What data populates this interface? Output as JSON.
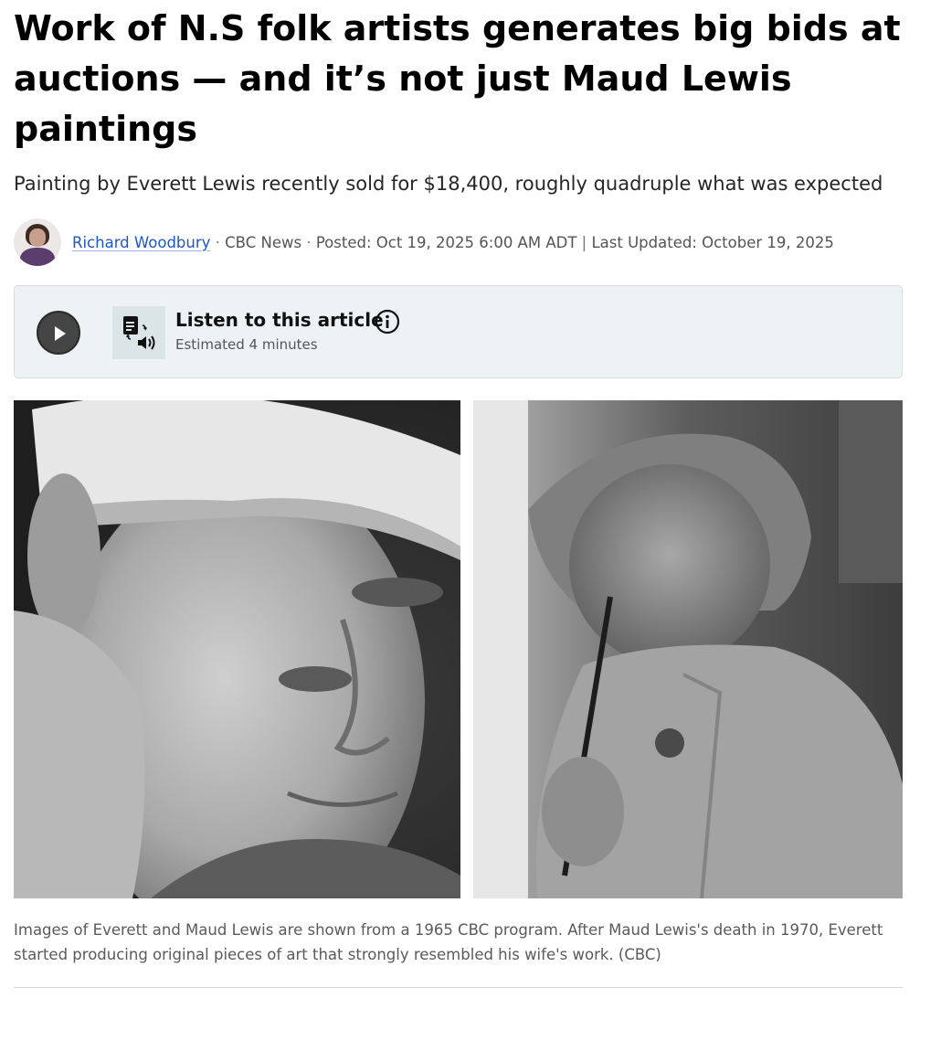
{
  "article": {
    "headline": "Work of N.S folk artists generates big bids at auctions — and it’s not just Maud Lewis paintings",
    "subheadline": "Painting by Everett Lewis recently sold for $18,400, roughly quadruple what was expected",
    "byline": {
      "author": "Richard Woodbury",
      "outlet": "CBC News",
      "posted": "Posted: Oct 19, 2025 6:00 AM ADT",
      "updated": "Last Updated: October 19, 2025",
      "dot_separator": "·",
      "pipe_separator": "|"
    },
    "audio_player": {
      "title": "Listen to this article",
      "duration": "Estimated 4 minutes",
      "play_icon": "play-icon",
      "tts_icon": "document-to-audio-icon",
      "info_icon": "info-icon"
    },
    "photo": {
      "left_subject": "Everett Lewis portrait (black and white)",
      "right_subject": "Maud Lewis painting (black and white)",
      "caption": "Images of Everett and Maud Lewis are shown from a 1965 CBC program. After Maud Lewis's death in 1970, Everett started producing original pieces of art that strongly resembled his wife's work. (CBC)"
    }
  },
  "colors": {
    "link": "#1f56c8",
    "audio_bg": "#edf3f5",
    "play_button": "#454545",
    "text": "#1a1a1a",
    "muted": "#545454"
  }
}
